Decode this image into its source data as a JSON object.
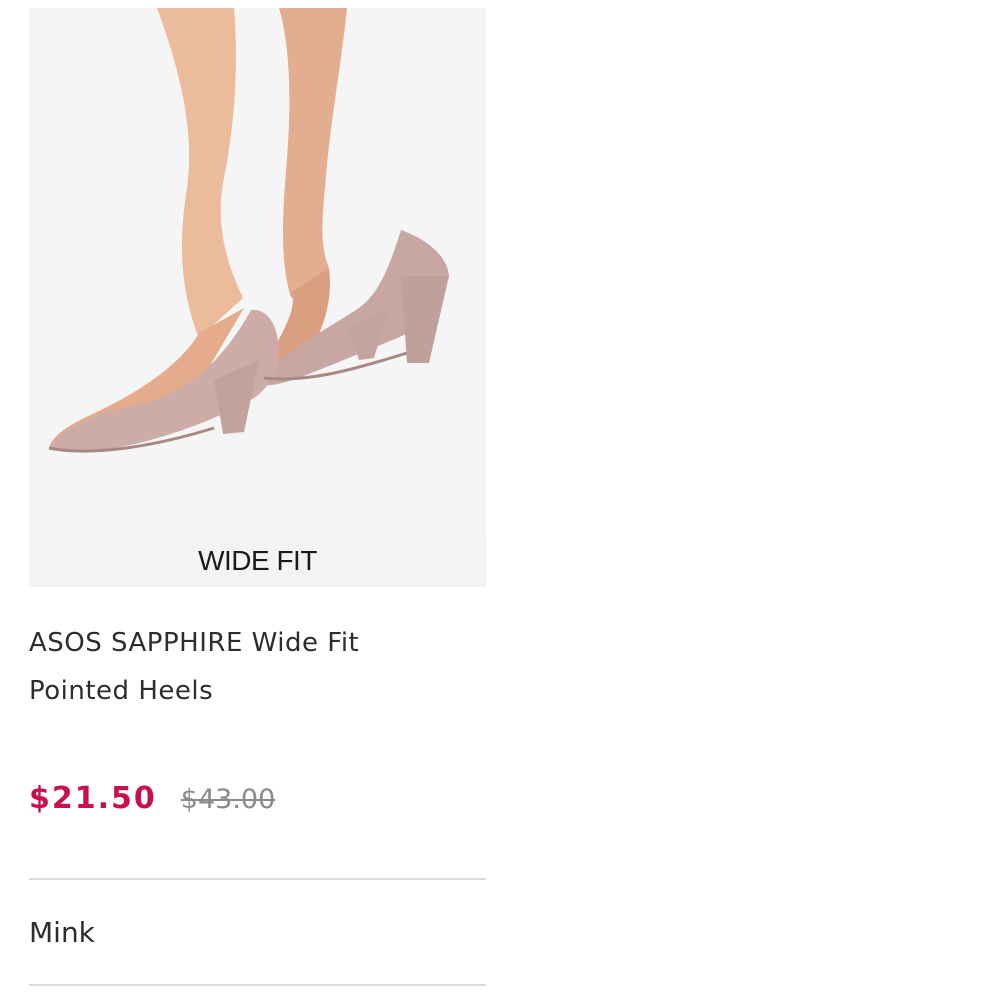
{
  "product": {
    "fit_label": "WIDE FIT",
    "title_line1": "ASOS SAPPHIRE Wide Fit",
    "title_line2": "Pointed Heels",
    "price_current": "$21.50",
    "price_original": "$43.00",
    "colour": "Mink"
  },
  "colors": {
    "sale_price": "#c8104e",
    "shoe": "#c9aaa6",
    "skin": "#e8b898"
  },
  "icons": {
    "product_image": "photo-of-pointed-heels"
  }
}
